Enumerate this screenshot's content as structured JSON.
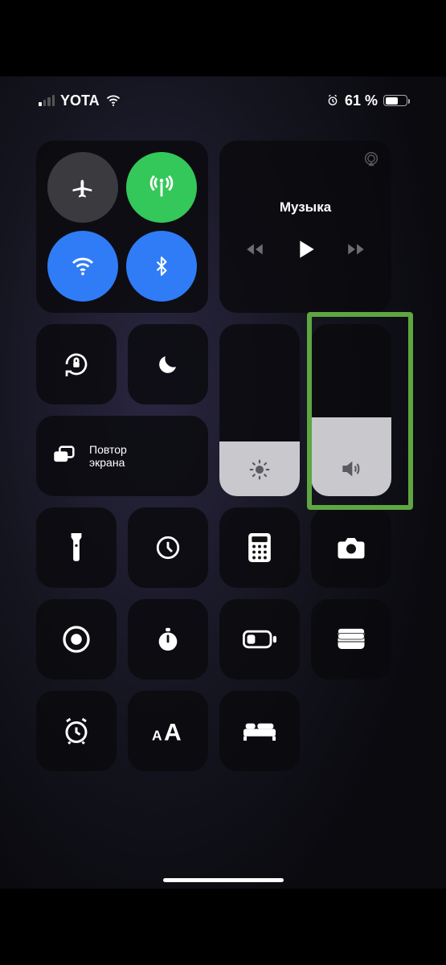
{
  "status": {
    "carrier": "YOTA",
    "battery_text": "61 %",
    "battery_pct": 61
  },
  "media": {
    "title": "Музыка"
  },
  "screen_mirror": {
    "label_line1": "Повтор",
    "label_line2": "экрана"
  },
  "sliders": {
    "brightness_pct": 32,
    "volume_pct": 46
  },
  "highlight": {
    "target": "volume-slider"
  },
  "colors": {
    "green": "#34c759",
    "blue": "#2f7cf6",
    "highlight": "#5fa641"
  }
}
